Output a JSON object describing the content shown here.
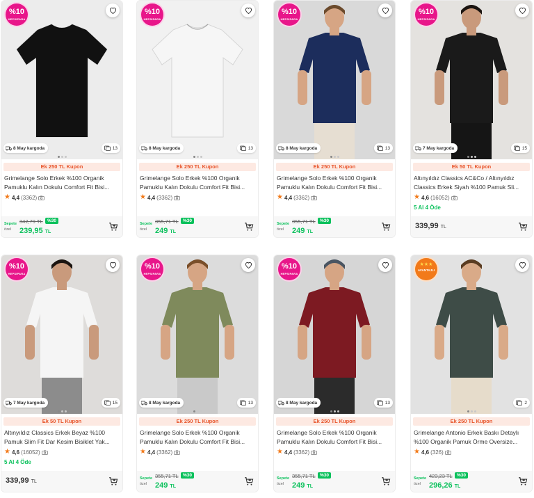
{
  "products": [
    {
      "badge": {
        "type": "hepsipara",
        "big": "%10",
        "small": "HEPSIPARA"
      },
      "shipping": "8 May kargoda",
      "photo_count": "13",
      "coupon": "Ek 250 TL Kupon",
      "title": "Grimelange Solo Erkek %100 Organik Pamuklu Kalın Dokulu Comfort Fit Bisi...",
      "rating": "4,4",
      "review_count": "(3362)",
      "installment": "",
      "price_type": "basket",
      "basket_label": "Sepete",
      "basket_label2": "özel",
      "old_price": "342,79 TL",
      "discount": "%30",
      "price_main": "239,95",
      "price_currency": "TL",
      "image": {
        "bg": "#ececec",
        "shirt": "#111111",
        "kind": "flat"
      }
    },
    {
      "badge": {
        "type": "hepsipara",
        "big": "%10",
        "small": "HEPSIPARA"
      },
      "shipping": "8 May kargoda",
      "photo_count": "13",
      "coupon": "Ek 250 TL Kupon",
      "title": "Grimelange Solo Erkek %100 Organik Pamuklu Kalın Dokulu Comfort Fit Bisi...",
      "rating": "4,4",
      "review_count": "(3362)",
      "installment": "",
      "price_type": "basket",
      "basket_label": "Sepete",
      "basket_label2": "özel",
      "old_price": "355,71 TL",
      "discount": "%30",
      "price_main": "249",
      "price_currency": "TL",
      "image": {
        "bg": "#f1f1f1",
        "shirt": "#f6f6f6",
        "kind": "flat"
      }
    },
    {
      "badge": {
        "type": "hepsipara",
        "big": "%10",
        "small": "HEPSIPARA"
      },
      "shipping": "8 May kargoda",
      "photo_count": "13",
      "coupon": "Ek 250 TL Kupon",
      "title": "Grimelange Solo Erkek %100 Organik Pamuklu Kalın Dokulu Comfort Fit Bisi...",
      "rating": "4,4",
      "review_count": "(3362)",
      "installment": "",
      "price_type": "basket",
      "basket_label": "Sepete",
      "basket_label2": "özel",
      "old_price": "355,71 TL",
      "discount": "%30",
      "price_main": "249",
      "price_currency": "TL",
      "image": {
        "bg": "#d9d9d9",
        "shirt": "#1c2d5c",
        "kind": "model",
        "pants": "#e6ded2",
        "skin": "#d6a584",
        "hair": "#6b4a2c"
      }
    },
    {
      "badge": {
        "type": "hepsipara",
        "big": "%10",
        "small": "HEPSIPARA"
      },
      "shipping": "7 May kargoda",
      "photo_count": "15",
      "coupon": "Ek 50 TL Kupon",
      "title": "Altınyıldız Classics AC&Co / Altınyıldız Classics Erkek Siyah %100 Pamuk Sli...",
      "rating": "4,6",
      "review_count": "(16052)",
      "installment": "5 Al 4 Öde",
      "price_type": "plain",
      "price_main": "339,99",
      "price_currency": "TL",
      "image": {
        "bg": "#e4e2df",
        "shirt": "#1a1a1a",
        "kind": "model",
        "pants": "#151515",
        "skin": "#c99a7c",
        "hair": "#1b1410"
      }
    },
    {
      "badge": {
        "type": "hepsipara",
        "big": "%10",
        "small": "HEPSIPARA"
      },
      "shipping": "7 May kargoda",
      "photo_count": "15",
      "coupon": "Ek 50 TL Kupon",
      "title": "Altınyıldız Classics Erkek Beyaz %100 Pamuk Slim Fit Dar Kesim Bisiklet Yak...",
      "rating": "4,6",
      "review_count": "(16052)",
      "installment": "5 Al 4 Öde",
      "price_type": "plain",
      "price_main": "339,99",
      "price_currency": "TL",
      "image": {
        "bg": "#dedcda",
        "shirt": "#f5f5f5",
        "kind": "model",
        "pants": "#8c8c8c",
        "skin": "#c99a7c",
        "hair": "#1b1410"
      }
    },
    {
      "badge": {
        "type": "hepsipara",
        "big": "%10",
        "small": "HEPSIPARA"
      },
      "shipping": "8 May kargoda",
      "photo_count": "13",
      "coupon": "Ek 250 TL Kupon",
      "title": "Grimelange Solo Erkek %100 Organik Pamuklu Kalın Dokulu Comfort Fit Bisi...",
      "rating": "4,4",
      "review_count": "(3362)",
      "installment": "",
      "price_type": "basket",
      "basket_label": "Sepete",
      "basket_label2": "özel",
      "old_price": "355,71 TL",
      "discount": "%30",
      "price_main": "249",
      "price_currency": "TL",
      "image": {
        "bg": "#dcdcdc",
        "shirt": "#7f8a5c",
        "kind": "model",
        "pants": "#c9c9c9",
        "skin": "#d6a584",
        "hair": "#7a4f2a"
      }
    },
    {
      "badge": {
        "type": "hepsipara",
        "big": "%10",
        "small": "HEPSIPARA"
      },
      "shipping": "8 May kargoda",
      "photo_count": "13",
      "coupon": "Ek 250 TL Kupon",
      "title": "Grimelange Solo Erkek %100 Organik Pamuklu Kalın Dokulu Comfort Fit Bisi...",
      "rating": "4,4",
      "review_count": "(3362)",
      "installment": "",
      "price_type": "basket",
      "basket_label": "Sepete",
      "basket_label2": "özel",
      "old_price": "355,71 TL",
      "discount": "%30",
      "price_main": "249",
      "price_currency": "TL",
      "image": {
        "bg": "#d6d6d6",
        "shirt": "#7d1a22",
        "kind": "model",
        "pants": "#2b2b2b",
        "skin": "#d6a584",
        "hair": "#4a5562"
      }
    },
    {
      "badge": {
        "type": "avantajli",
        "small": "AVANTAJLI"
      },
      "shipping": "",
      "photo_count": "2",
      "coupon": "Ek 250 TL Kupon",
      "title": "Grimelange Antonio Erkek Baskı Detaylı %100 Organik Pamuk Örme Oversize...",
      "rating": "4,6",
      "review_count": "(326)",
      "installment": "",
      "price_type": "basket",
      "basket_label": "Sepete",
      "basket_label2": "özel",
      "old_price": "423,23 TL",
      "discount": "%30",
      "price_main": "296,26",
      "price_currency": "TL",
      "image": {
        "bg": "#e2e2e2",
        "shirt": "#3e4c47",
        "kind": "model",
        "pants": "#e6dccb",
        "skin": "#d9aa88",
        "hair": "#5a3c22"
      }
    }
  ],
  "colors": {
    "accent_green": "#0bc15c",
    "coupon_text": "#e8542a",
    "hepsipara_pink": "#e8168a",
    "star_orange": "#f27a1a"
  },
  "icons": {
    "favorite": "heart-icon",
    "cart": "add-to-cart-icon",
    "shipping": "truck-icon",
    "photos": "photo-review-icon",
    "rating": "star-icon"
  }
}
